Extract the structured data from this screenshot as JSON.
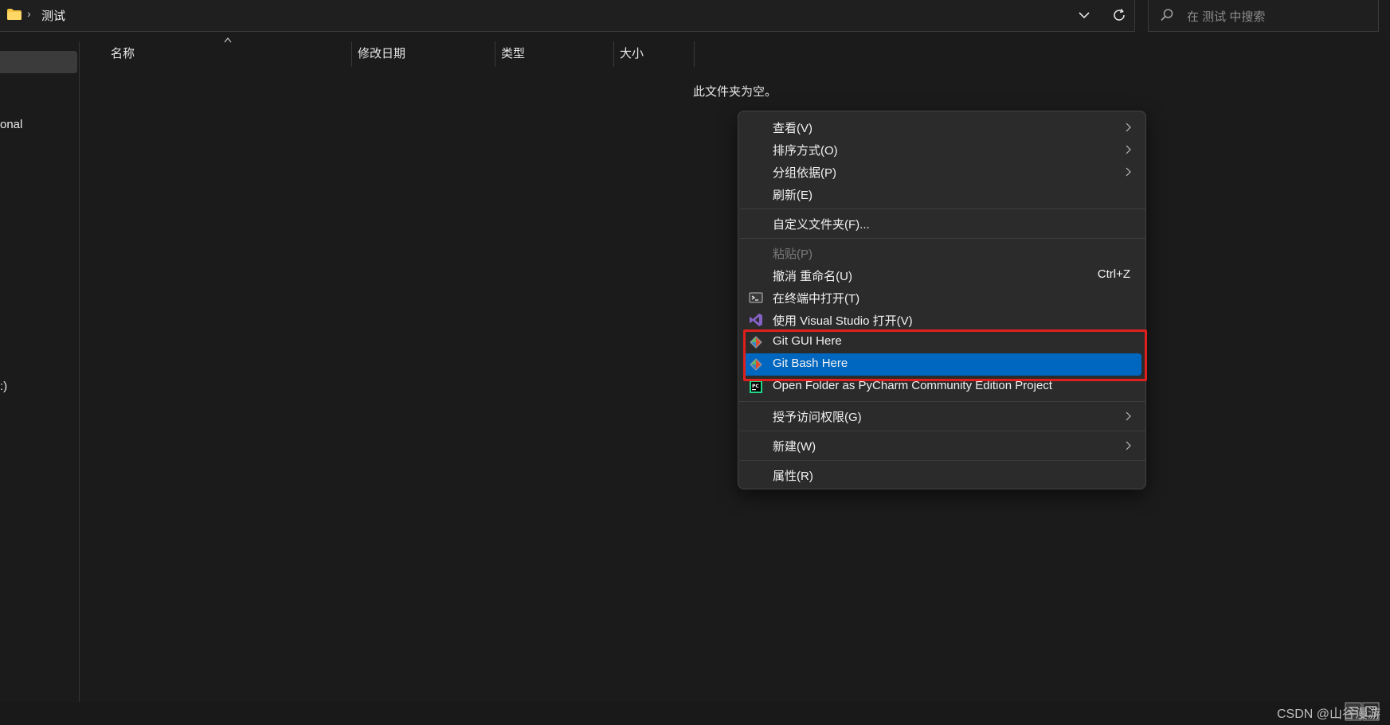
{
  "address_bar": {
    "breadcrumb_separator": "›",
    "current_folder": "测试"
  },
  "search": {
    "placeholder": "在 测试 中搜索"
  },
  "nav_pane": {
    "items": [
      {
        "label": "onal"
      },
      {
        "label": ":)"
      }
    ]
  },
  "columns": [
    {
      "label": "名称"
    },
    {
      "label": "修改日期"
    },
    {
      "label": "类型"
    },
    {
      "label": "大小"
    }
  ],
  "empty_message": "此文件夹为空。",
  "context_menu": {
    "items": [
      {
        "label": "查看(V)",
        "submenu": true
      },
      {
        "label": "排序方式(O)",
        "submenu": true
      },
      {
        "label": "分组依据(P)",
        "submenu": true
      },
      {
        "label": "刷新(E)"
      },
      {
        "label": "自定义文件夹(F)..."
      },
      {
        "label": "粘贴(P)",
        "disabled": true
      },
      {
        "label": "撤消 重命名(U)",
        "shortcut": "Ctrl+Z"
      },
      {
        "label": "在终端中打开(T)",
        "icon": "terminal-icon"
      },
      {
        "label": "使用 Visual Studio 打开(V)",
        "icon": "visual-studio-icon"
      },
      {
        "label": "Git GUI Here",
        "icon": "git-icon"
      },
      {
        "label": "Git Bash Here",
        "icon": "git-icon",
        "highlighted": true
      },
      {
        "label": "Open Folder as PyCharm Community Edition Project",
        "icon": "pycharm-icon"
      },
      {
        "label": "授予访问权限(G)",
        "submenu": true
      },
      {
        "label": "新建(W)",
        "submenu": true
      },
      {
        "label": "属性(R)"
      }
    ]
  },
  "watermark": "CSDN @山谷漫游",
  "colors": {
    "background": "#1b1b1b",
    "menu_background": "#2b2b2b",
    "highlight": "#0067c0",
    "annotation_red": "#e0201c",
    "folder_yellow": "#f4c542",
    "vs_purple": "#8661c5"
  }
}
